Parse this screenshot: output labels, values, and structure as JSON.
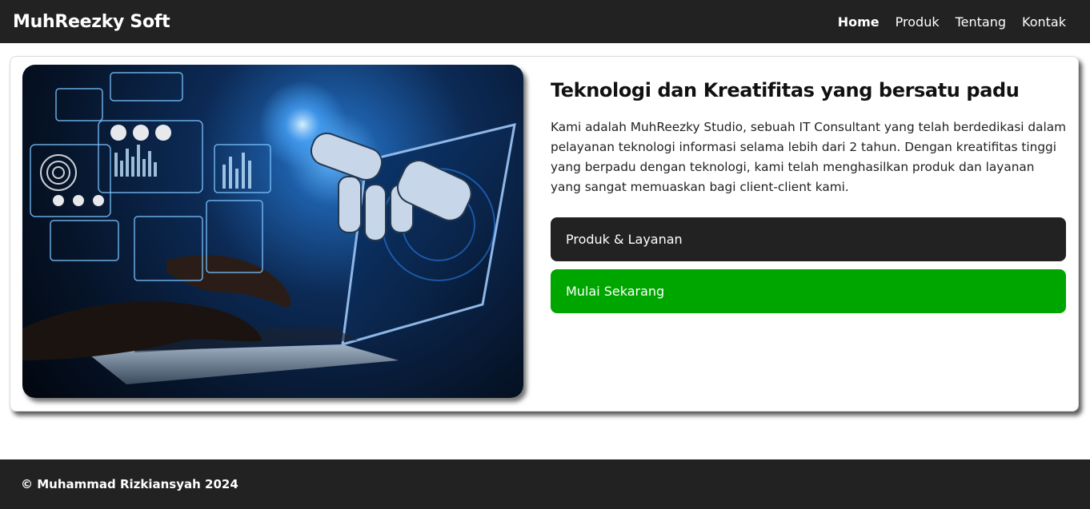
{
  "navbar": {
    "brand": "MuhReezky Soft",
    "links": [
      "Home",
      "Produk",
      "Tentang",
      "Kontak"
    ],
    "active": "Home"
  },
  "hero": {
    "image_description_icon": "laptop-robot-hand-image",
    "title": "Teknologi dan Kreatifitas yang bersatu padu",
    "description": "Kami adalah MuhReezky Studio, sebuah IT Consultant yang telah berdedikasi dalam pelayanan teknologi informasi selama lebih dari 2 tahun. Dengan kreatifitas tinggi yang berpadu dengan teknologi, kami telah menghasilkan produk dan layanan yang sangat memuaskan bagi client-client kami.",
    "primary_button": "Produk & Layanan",
    "secondary_button": "Mulai Sekarang"
  },
  "footer": {
    "text": "© Muhammad Rizkiansyah 2024"
  },
  "colors": {
    "nav_bg": "#222222",
    "primary_button": "#222222",
    "secondary_button": "#00a600",
    "text": "#111111"
  }
}
